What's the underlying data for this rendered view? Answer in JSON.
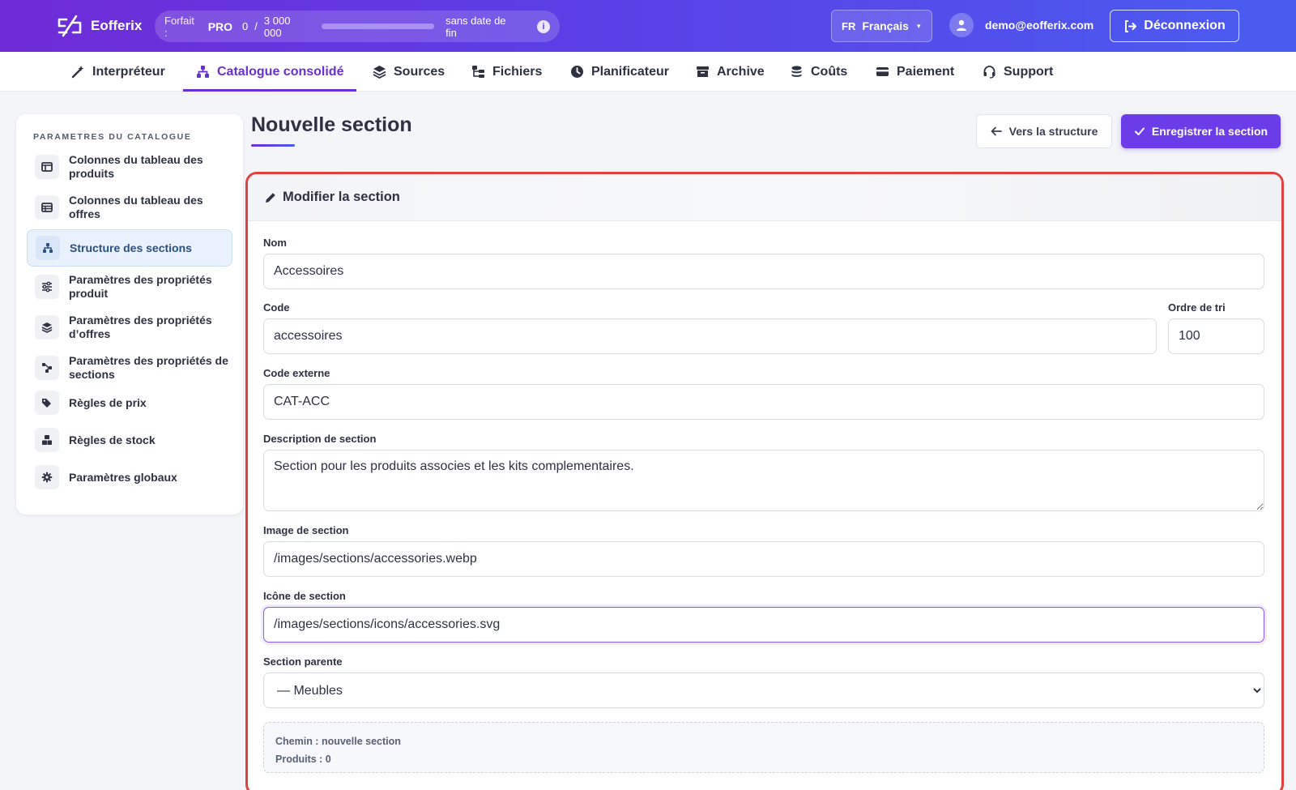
{
  "app": {
    "name": "Eofferix"
  },
  "plan": {
    "label": "Forfait :",
    "tier": "PRO",
    "used": "0",
    "separator": "/",
    "limit": "3 000 000",
    "usage_fraction": 0.0,
    "expiry": "sans date de fin",
    "info_glyph": "i"
  },
  "lang": {
    "code": "FR",
    "name": "Français",
    "caret": "▾"
  },
  "user": {
    "email": "demo@eofferix.com"
  },
  "logout_label": "Déconnexion",
  "nav": [
    {
      "label": "Interpréteur",
      "icon": "wand-icon"
    },
    {
      "label": "Catalogue consolidé",
      "icon": "sitemap-icon",
      "active": true
    },
    {
      "label": "Sources",
      "icon": "layers-icon"
    },
    {
      "label": "Fichiers",
      "icon": "folder-tree-icon"
    },
    {
      "label": "Planificateur",
      "icon": "clock-icon"
    },
    {
      "label": "Archive",
      "icon": "archive-icon"
    },
    {
      "label": "Coûts",
      "icon": "coins-icon"
    },
    {
      "label": "Paiement",
      "icon": "credit-card-icon"
    },
    {
      "label": "Support",
      "icon": "headset-icon"
    }
  ],
  "sidebar": {
    "heading": "PARAMETRES DU CATALOGUE",
    "items": [
      {
        "label": "Colonnes du tableau des produits",
        "icon": "columns-icon"
      },
      {
        "label": "Colonnes du tableau des offres",
        "icon": "table-icon"
      },
      {
        "label": "Structure des sections",
        "icon": "sitemap-icon",
        "active": true
      },
      {
        "label": "Paramètres des propriétés produit",
        "icon": "sliders-icon"
      },
      {
        "label": "Paramètres des propriétés d’offres",
        "icon": "layers-icon"
      },
      {
        "label": "Paramètres des propriétés de sections",
        "icon": "diagram-icon"
      },
      {
        "label": "Règles de prix",
        "icon": "tags-icon"
      },
      {
        "label": "Règles de stock",
        "icon": "boxes-icon"
      },
      {
        "label": "Paramètres globaux",
        "icon": "gear-icon"
      }
    ]
  },
  "page": {
    "title": "Nouvelle section",
    "back_label": "Vers la structure",
    "save_label": "Enregistrer la section"
  },
  "form": {
    "card_title": "Modifier la section",
    "name": {
      "label": "Nom",
      "value": "Accessoires"
    },
    "code": {
      "label": "Code",
      "value": "accessoires"
    },
    "sort": {
      "label": "Ordre de tri",
      "value": "100"
    },
    "external_code": {
      "label": "Code externe",
      "value": "CAT-ACC"
    },
    "description": {
      "label": "Description de section",
      "value": "Section pour les produits associes et les kits complementaires."
    },
    "image": {
      "label": "Image de section",
      "value": "/images/sections/accessories.webp"
    },
    "icon": {
      "label": "Icône de section",
      "value": "/images/sections/icons/accessories.svg"
    },
    "parent": {
      "label": "Section parente",
      "value": "— Meubles"
    },
    "path_line": "Chemin : nouvelle section",
    "products_line": "Produits : 0"
  },
  "colors": {
    "accent": "#6a3de8",
    "nav_active": "#6a2fd4",
    "highlight_border": "#e0413f"
  }
}
